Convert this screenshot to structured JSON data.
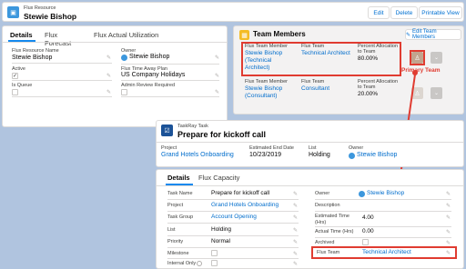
{
  "resource": {
    "object_label": "Flux Resource",
    "name": "Stewie Bishop",
    "actions": [
      "Edit",
      "Delete",
      "Printable View"
    ],
    "tabs": [
      "Details",
      "Flux Forecast",
      "Flux Actual Utilization"
    ],
    "fields": {
      "flux_resource_name_label": "Flux Resource Name",
      "flux_resource_name": "Stewie Bishop",
      "owner_label": "Owner",
      "owner": "Stewie Bishop",
      "active_label": "Active",
      "time_away_label": "Flux Time Away Plan",
      "time_away": "US Company Holidays",
      "is_queue_label": "Is Queue",
      "admin_review_label": "Admin Review Required"
    }
  },
  "team_members": {
    "title": "Team Members",
    "edit_button": "Edit Team Members",
    "rows": [
      {
        "member_label": "Flux Team Member",
        "member_line1": "Stewie Bishop",
        "member_line2": "(Technical",
        "member_line3": "Architect)",
        "team_label": "Flux Team",
        "team": "Technical Architect",
        "alloc_label1": "Percent Allocation",
        "alloc_label2": "to Team",
        "allocation": "80.00%"
      },
      {
        "member_label": "Flux Team Member",
        "member_line1": "Stewie Bishop",
        "member_line2": "(Consultant)",
        "team_label": "Flux Team",
        "team": "Consultant",
        "alloc_label1": "Percent Allocation",
        "alloc_label2": "to Team",
        "allocation": "20.00%"
      }
    ],
    "primary_team_label": "Primary Team"
  },
  "task": {
    "object_label": "TaskRay Task",
    "name": "Prepare for kickoff call",
    "project_label": "Project",
    "project": "Grand Hotels Onboarding",
    "end_date_label": "Estimated End Date",
    "end_date": "10/23/2019",
    "list_label": "List",
    "list": "Holding",
    "owner_label": "Owner",
    "owner": "Stewie Bishop",
    "tabs": [
      "Details",
      "Flux Capacity"
    ],
    "left_fields": [
      {
        "label": "Task Name",
        "value": "Prepare for kickoff call",
        "link": false
      },
      {
        "label": "Project",
        "value": "Grand Hotels Onboarding",
        "link": true
      },
      {
        "label": "Task Group",
        "value": "Account Opening",
        "link": true
      },
      {
        "label": "List",
        "value": "Holding",
        "link": false
      },
      {
        "label": "Priority",
        "value": "Normal",
        "link": false
      },
      {
        "label": "Milestone",
        "value": "",
        "link": false
      },
      {
        "label": "Internal Only",
        "value": "",
        "link": false
      }
    ],
    "right_fields": [
      {
        "label": "Owner",
        "value": "Stewie Bishop",
        "link": true
      },
      {
        "label": "Description",
        "value": "",
        "link": false
      },
      {
        "label": "Estimated Time (Hrs)",
        "value": "4.00",
        "link": false
      },
      {
        "label": "Actual Time (Hrs)",
        "value": "0.00",
        "link": false
      },
      {
        "label": "Archived",
        "value": "",
        "link": false
      },
      {
        "label": "Flux Team",
        "value": "Technical Architect",
        "link": true
      }
    ]
  },
  "colors": {
    "resource_icon": "#3c97dd",
    "task_icon": "#1b5297",
    "highlight": "#e03c31",
    "link": "#006dcc",
    "tab_active": "#1589ee"
  },
  "icons": [
    "flux-resource-icon",
    "team-members-icon",
    "taskray-task-icon",
    "user-avatar-icon",
    "pencil-icon",
    "primary-team-badge-icon",
    "dropdown-icon"
  ]
}
